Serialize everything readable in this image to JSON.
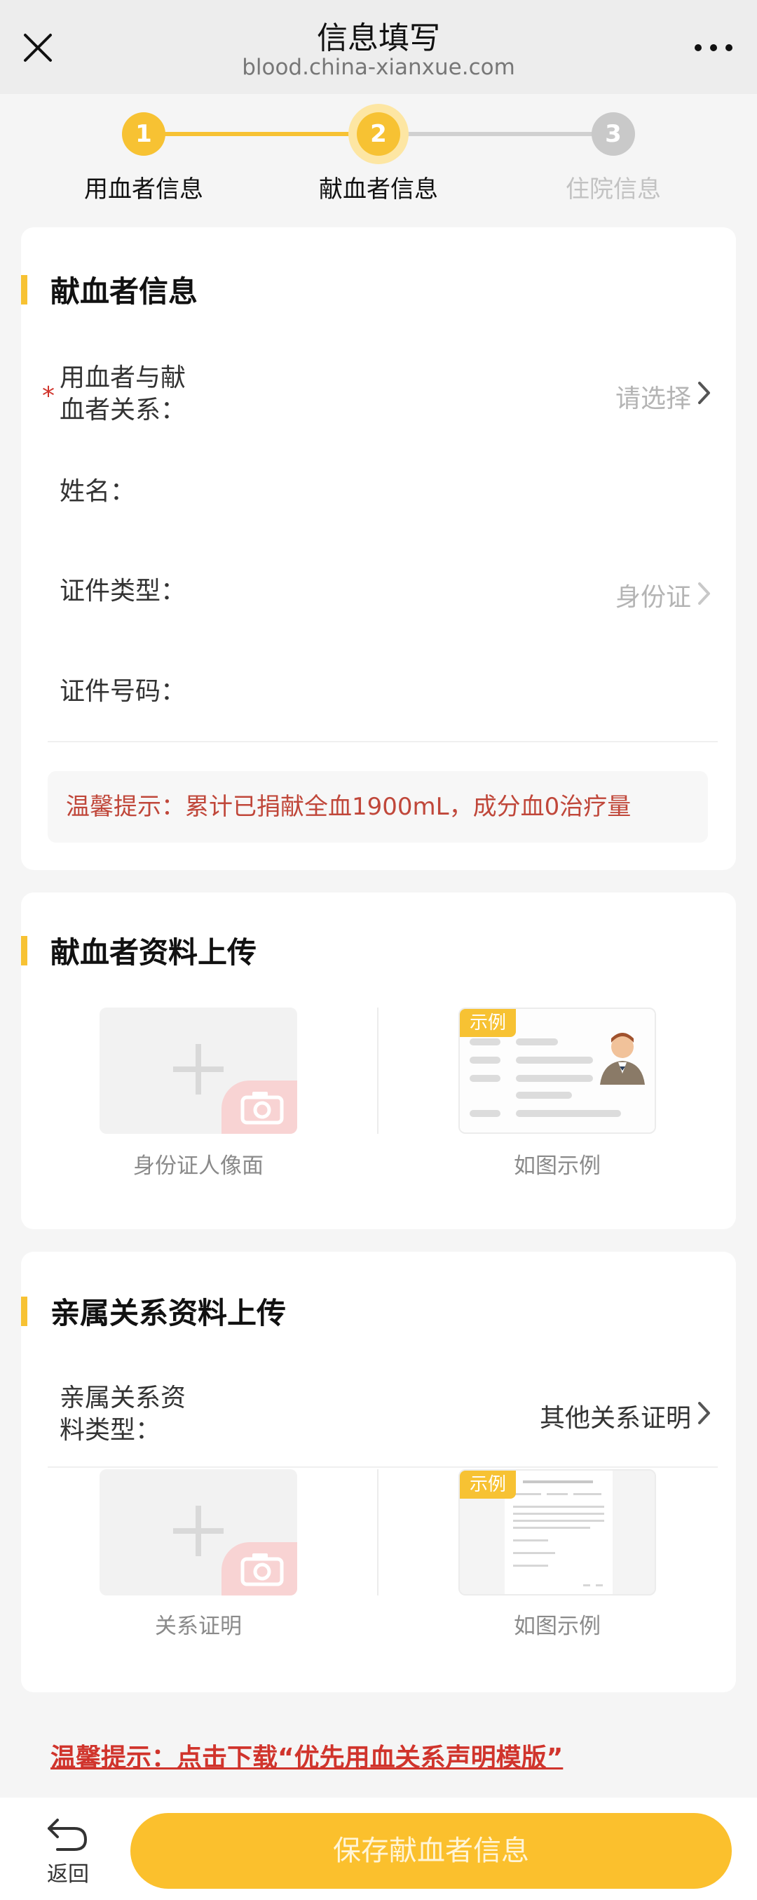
{
  "header": {
    "title": "信息填写",
    "url": "blood.china-xianxue.com"
  },
  "steps": [
    {
      "number": "1",
      "label": "用血者信息",
      "state": "done"
    },
    {
      "number": "2",
      "label": "献血者信息",
      "state": "active"
    },
    {
      "number": "3",
      "label": "住院信息",
      "state": "pending"
    }
  ],
  "donor_info": {
    "title": "献血者信息",
    "relation": {
      "label_line1": "用血者与献",
      "label_line2": "血者关系：",
      "value": "请选择",
      "required_mark": "*"
    },
    "name": {
      "label": "姓名："
    },
    "id_type": {
      "label": "证件类型：",
      "value": "身份证"
    },
    "id_number": {
      "label": "证件号码："
    },
    "tip": "温馨提示：累计已捐献全血1900mL，成分血0治疗量"
  },
  "donor_upload": {
    "title": "献血者资料上传",
    "upload_caption": "身份证人像面",
    "example_tag": "示例",
    "example_caption": "如图示例"
  },
  "relation_upload": {
    "title": "亲属关系资料上传",
    "type_label_line1": "亲属关系资",
    "type_label_line2": "料类型：",
    "type_value": "其他关系证明",
    "upload_caption": "关系证明",
    "example_tag": "示例",
    "example_caption": "如图示例"
  },
  "bottom": {
    "tip_link": "温馨提示：点击下载“优先用血关系声明模版”",
    "back_label": "返回",
    "save_label": "保存献血者信息"
  },
  "colors": {
    "accent": "#f7c233",
    "tip_red": "#c0473a",
    "link_red": "#d0342c"
  }
}
